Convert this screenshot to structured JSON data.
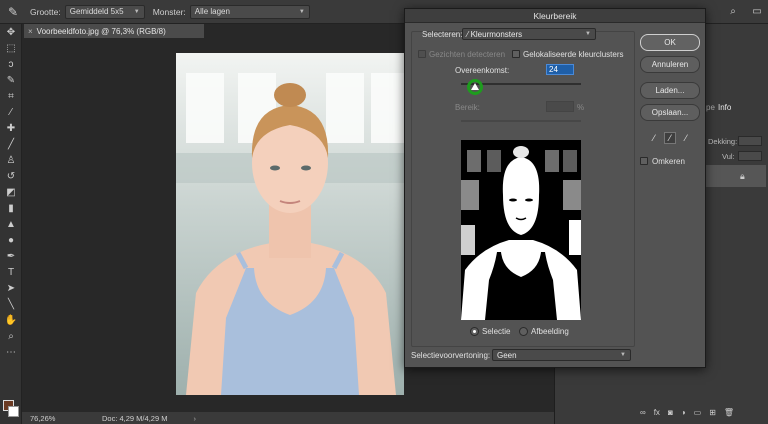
{
  "options_bar": {
    "size_label": "Grootte:",
    "size_value": "Gemiddeld 5x5",
    "sample_label": "Monster:",
    "sample_value": "Alle lagen",
    "tool_icon": "eyedropper-icon"
  },
  "document": {
    "tab_title": "Voorbeeldfoto.jpg @ 76,3% (RGB/8)",
    "close_glyph": "×"
  },
  "status_bar": {
    "zoom": "76,26%",
    "doc_info": "Doc: 4,29 M/4,29 M",
    "arrow": "›"
  },
  "right_panel": {
    "tab_info": "Info",
    "tab_prefix": "pe",
    "opacity_label": "Dekking:",
    "fill_label": "Vul:"
  },
  "dialog": {
    "title": "Kleurbereik",
    "select_label": "Selecteren:",
    "select_value": "Kleurmonsters",
    "detect_faces": "Gezichten detecteren",
    "localized_clusters": "Gelokaliseerde kleurclusters",
    "fuzziness_label": "Overeenkomst:",
    "fuzziness_value": "24",
    "range_label": "Bereik:",
    "range_unit": "%",
    "fuzziness_fraction": 0.12,
    "radio_selection": "Selectie",
    "radio_image": "Afbeelding",
    "preview_label": "Selectievoorvertoning:",
    "preview_value": "Geen",
    "btn_ok": "OK",
    "btn_cancel": "Annuleren",
    "btn_load": "Laden...",
    "btn_save": "Opslaan...",
    "invert_label": "Omkeren",
    "highlight_color": "#1e9c1e"
  }
}
